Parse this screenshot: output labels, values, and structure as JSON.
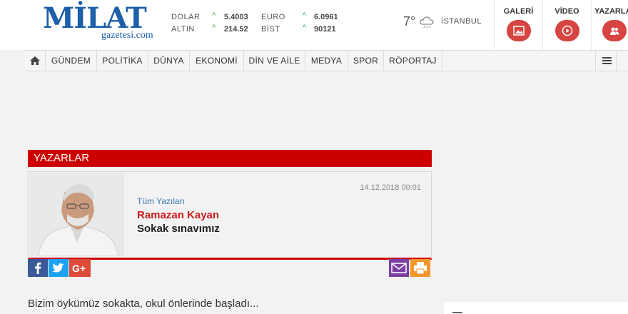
{
  "logo": {
    "main": "MİLAT",
    "sub": "gazetesi.com"
  },
  "markets": [
    {
      "name": "DOLAR",
      "value": "5.4003"
    },
    {
      "name": "EURO",
      "value": "6.0961"
    },
    {
      "name": "ALTIN",
      "value": "214.52"
    },
    {
      "name": "BİST",
      "value": "90121"
    }
  ],
  "weather": {
    "temp": "7°",
    "city": "İSTANBUL",
    "icon": "rain-cloud-icon"
  },
  "header_buttons": [
    {
      "label": "GALERİ",
      "icon": "image-icon"
    },
    {
      "label": "VİDEO",
      "icon": "play-icon"
    },
    {
      "label": "YAZARLAR",
      "icon": "users-icon"
    }
  ],
  "nav": {
    "items": [
      "GÜNDEM",
      "POLİTİKA",
      "DÜNYA",
      "EKONOMİ",
      "DİN VE AİLE",
      "MEDYA",
      "SPOR",
      "RÖPORTAJ"
    ]
  },
  "section": {
    "title": "YAZARLAR"
  },
  "article": {
    "date": "14.12.2018 00:01",
    "all_link": "Tüm Yazıları",
    "author": "Ramazan Kayan",
    "title": "Sokak sınavımız",
    "intro": "Bizim öykümüz sokakta, okul önlerinde başladı..."
  },
  "share": [
    {
      "icon": "facebook-icon",
      "color": "#3b5998"
    },
    {
      "icon": "twitter-icon",
      "color": "#1da1f2"
    },
    {
      "icon": "google-plus-icon",
      "color": "#dd4b39"
    },
    {
      "icon": "email-icon",
      "color": "#7b3fa0"
    },
    {
      "icon": "print-icon",
      "color": "#f5962a"
    }
  ],
  "colors": {
    "brand_blue": "#1d5fa8",
    "accent_red": "#cc0000",
    "up_green": "#2eae4f"
  }
}
